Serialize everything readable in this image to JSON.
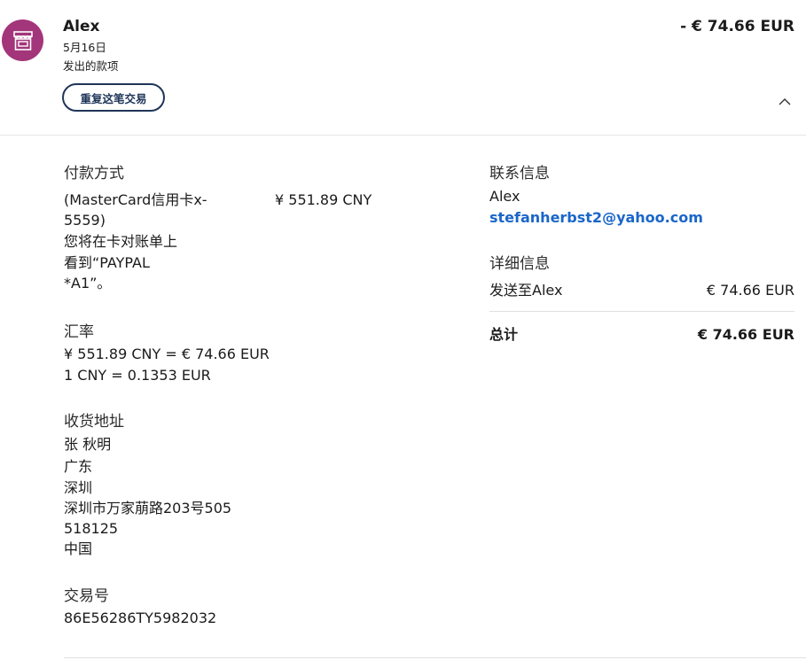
{
  "header": {
    "merchant_name": "Alex",
    "date": "5月16日",
    "transaction_type": "发出的款项",
    "repeat_button_label": "重复这笔交易",
    "amount": "- € 74.66 EUR",
    "avatar_icon": "storefront-icon",
    "avatar_color": "#a3357a"
  },
  "payment_method": {
    "label": "付款方式",
    "card_lines": [
      "(MasterCard信用卡x-",
      "5559)",
      "您将在卡对账单上",
      "看到“PAYPAL",
      "*A1”。"
    ],
    "amount": "¥ 551.89 CNY"
  },
  "exchange_rate": {
    "label": "汇率",
    "line1": "¥ 551.89 CNY = € 74.66 EUR",
    "line2": "1 CNY = 0.1353 EUR"
  },
  "shipping_address": {
    "label": "收货地址",
    "lines": [
      "张 秋明",
      "广东",
      "深圳",
      "深圳市万家萠路203号505",
      "518125",
      "中国"
    ]
  },
  "transaction_id": {
    "label": "交易号",
    "value": "86E56286TY5982032"
  },
  "contact": {
    "label": "联系信息",
    "name": "Alex",
    "email": "stefanherbst2@yahoo.com"
  },
  "details": {
    "label": "详细信息",
    "sent_to_label": "发送至Alex",
    "sent_to_amount": "€ 74.66 EUR",
    "total_label": "总计",
    "total_amount": "€ 74.66 EUR"
  },
  "colors": {
    "link": "#1a66c9",
    "button_border": "#1f3558"
  }
}
